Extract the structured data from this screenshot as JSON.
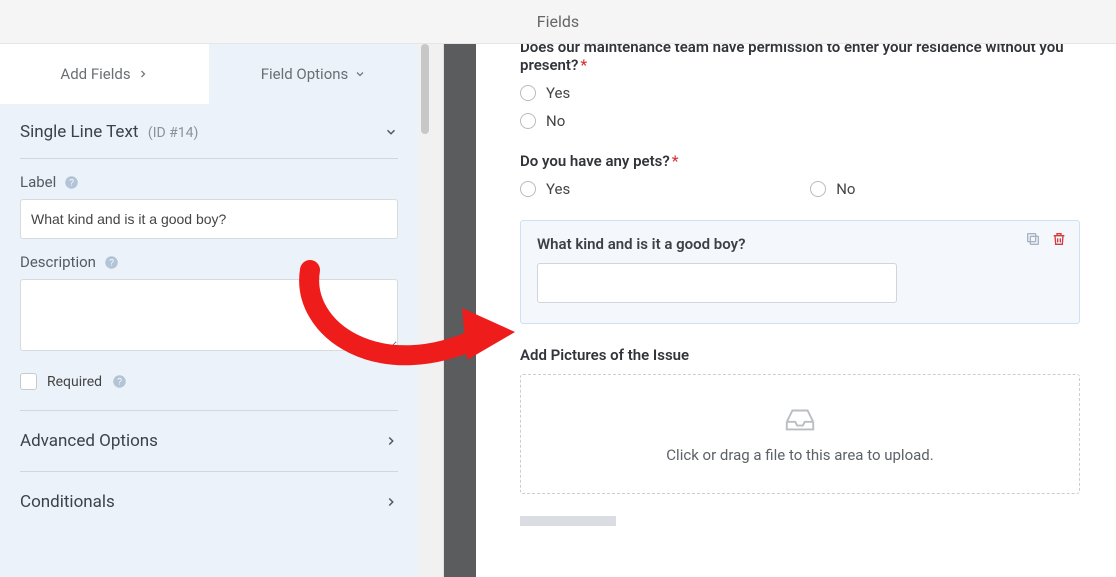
{
  "header": {
    "title": "Fields"
  },
  "tabs": {
    "add_fields": "Add Fields",
    "field_options": "Field Options"
  },
  "section": {
    "title": "Single Line Text",
    "id_label": "(ID #14)"
  },
  "labels": {
    "label": "Label",
    "description": "Description",
    "required": "Required",
    "advanced": "Advanced Options",
    "conditionals": "Conditionals"
  },
  "inputs": {
    "label_value": "What kind and is it a good boy?"
  },
  "preview": {
    "q1": {
      "label": "Does our maintenance team have permission to enter your residence without you present?",
      "opts": [
        "Yes",
        "No"
      ]
    },
    "q2": {
      "label": "Do you have any pets?",
      "opts": [
        "Yes",
        "No"
      ]
    },
    "selected": {
      "label": "What kind and is it a good boy?"
    },
    "upload": {
      "label": "Add Pictures of the Issue",
      "hint": "Click or drag a file to this area to upload."
    }
  }
}
